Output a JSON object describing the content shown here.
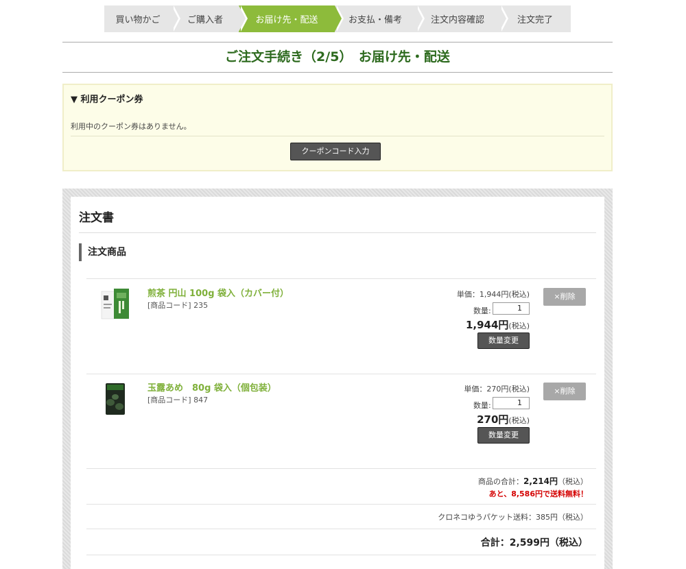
{
  "steps": [
    "買い物かご",
    "ご購入者",
    "お届け先・配送",
    "お支払・備考",
    "注文内容確認",
    "注文完了"
  ],
  "page_title": "ご注文手続き（2/5）　お届け先・配送",
  "coupon": {
    "heading": "▼ 利用クーポン券",
    "message": "利用中のクーポン券はありません。",
    "button": "クーポンコード入力"
  },
  "order": {
    "title": "注文書",
    "section_title": "注文商品",
    "items": [
      {
        "name": "煎茶 円山 100g 袋入（カバー付）",
        "code": "[商品コード] 235",
        "unit_price": "単価：1,944円(税込)",
        "qty_label": "数量:",
        "qty": "1",
        "total": "1,944円",
        "tax": "(税込)",
        "qty_button": "数量変更",
        "delete_button": "×削除"
      },
      {
        "name": "玉露あめ　80g 袋入（個包装）",
        "code": "[商品コード] 847",
        "unit_price": "単価：270円(税込)",
        "qty_label": "数量:",
        "qty": "1",
        "total": "270円",
        "tax": "(税込)",
        "qty_button": "数量変更",
        "delete_button": "×削除"
      }
    ],
    "subtotal_label": "商品の合計：",
    "subtotal_value": "2,214円",
    "subtotal_tax": "（税込）",
    "free_shipping_note": "あと、8,586円で送料無料！",
    "shipping": "クロネコゆうパケット送料：385円（税込）",
    "grand_total": "合計：2,599円（税込）"
  },
  "colors": {
    "accent_green": "#8dbb3b",
    "title_green": "#2d6a1e",
    "product_link": "#7fb03a",
    "alert_red": "#d40000"
  }
}
